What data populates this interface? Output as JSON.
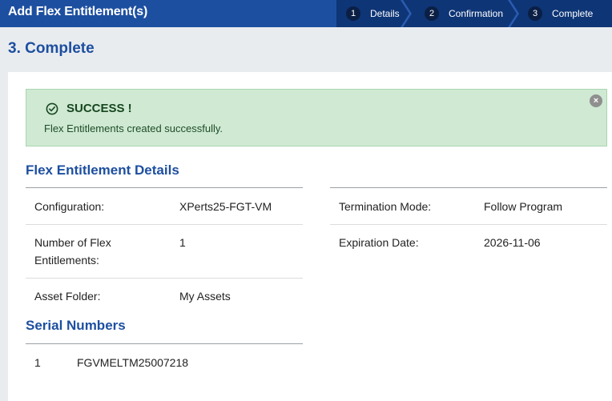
{
  "header": {
    "title": "Add Flex Entitlement(s)",
    "steps": [
      {
        "number": "1",
        "label": "Details"
      },
      {
        "number": "2",
        "label": "Confirmation"
      },
      {
        "number": "3",
        "label": "Complete"
      }
    ]
  },
  "page_title": "3. Complete",
  "alert": {
    "heading": "SUCCESS !",
    "message": "Flex Entitlements created successfully.",
    "close_symbol": "×",
    "icon": "check-circle-icon",
    "background": "#cfe9d3"
  },
  "details": {
    "title": "Flex Entitlement Details",
    "left": [
      {
        "label": "Configuration:",
        "value": "XPerts25-FGT-VM"
      },
      {
        "label": "Number of Flex Entitlements:",
        "value": "1"
      },
      {
        "label": "Asset Folder:",
        "value": "My Assets"
      }
    ],
    "right": [
      {
        "label": "Termination Mode:",
        "value": "Follow Program"
      },
      {
        "label": "Expiration Date:",
        "value": "2026-11-06"
      }
    ]
  },
  "serials": {
    "title": "Serial Numbers",
    "rows": [
      {
        "index": "1",
        "serial": "FGVMELTM25007218"
      }
    ]
  },
  "colors": {
    "brand": "#1d4fa0",
    "step_bar": "#0e3576",
    "success_text": "#17461f"
  }
}
